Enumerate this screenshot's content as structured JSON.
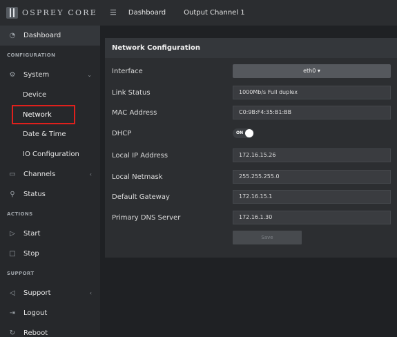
{
  "brand": {
    "name": "OSPREY CORE",
    "logo_icon": "osprey-logo-icon"
  },
  "topbar": {
    "menu_icon": "hamburger-menu-icon",
    "crumbs": [
      "Dashboard",
      "Output Channel 1"
    ]
  },
  "sidebar": {
    "dashboard": "Dashboard",
    "section_configuration": "CONFIGURATION",
    "system": "System",
    "device": "Device",
    "network": "Network",
    "date_time": "Date & Time",
    "io_configuration": "IO Configuration",
    "channels": "Channels",
    "status": "Status",
    "section_actions": "ACTIONS",
    "start": "Start",
    "stop": "Stop",
    "section_support": "SUPPORT",
    "support": "Support",
    "logout": "Logout",
    "reboot": "Reboot",
    "highlight_color": "#e0201c"
  },
  "panel": {
    "title": "Network Configuration",
    "interface": {
      "label": "Interface",
      "value": "eth0 ▾"
    },
    "link_status": {
      "label": "Link Status",
      "value": "1000Mb/s Full duplex"
    },
    "mac_address": {
      "label": "MAC Address",
      "value": "C0:9B:F4:35:B1:BB"
    },
    "dhcp": {
      "label": "DHCP",
      "toggle_text": "ON",
      "state": true
    },
    "local_ip": {
      "label": "Local IP Address",
      "value": "172.16.15.26"
    },
    "netmask": {
      "label": "Local Netmask",
      "value": "255.255.255.0"
    },
    "gateway": {
      "label": "Default Gateway",
      "value": "172.16.15.1"
    },
    "dns": {
      "label": "Primary DNS Server",
      "value": "172.16.1.30"
    },
    "save_label": "Save"
  }
}
